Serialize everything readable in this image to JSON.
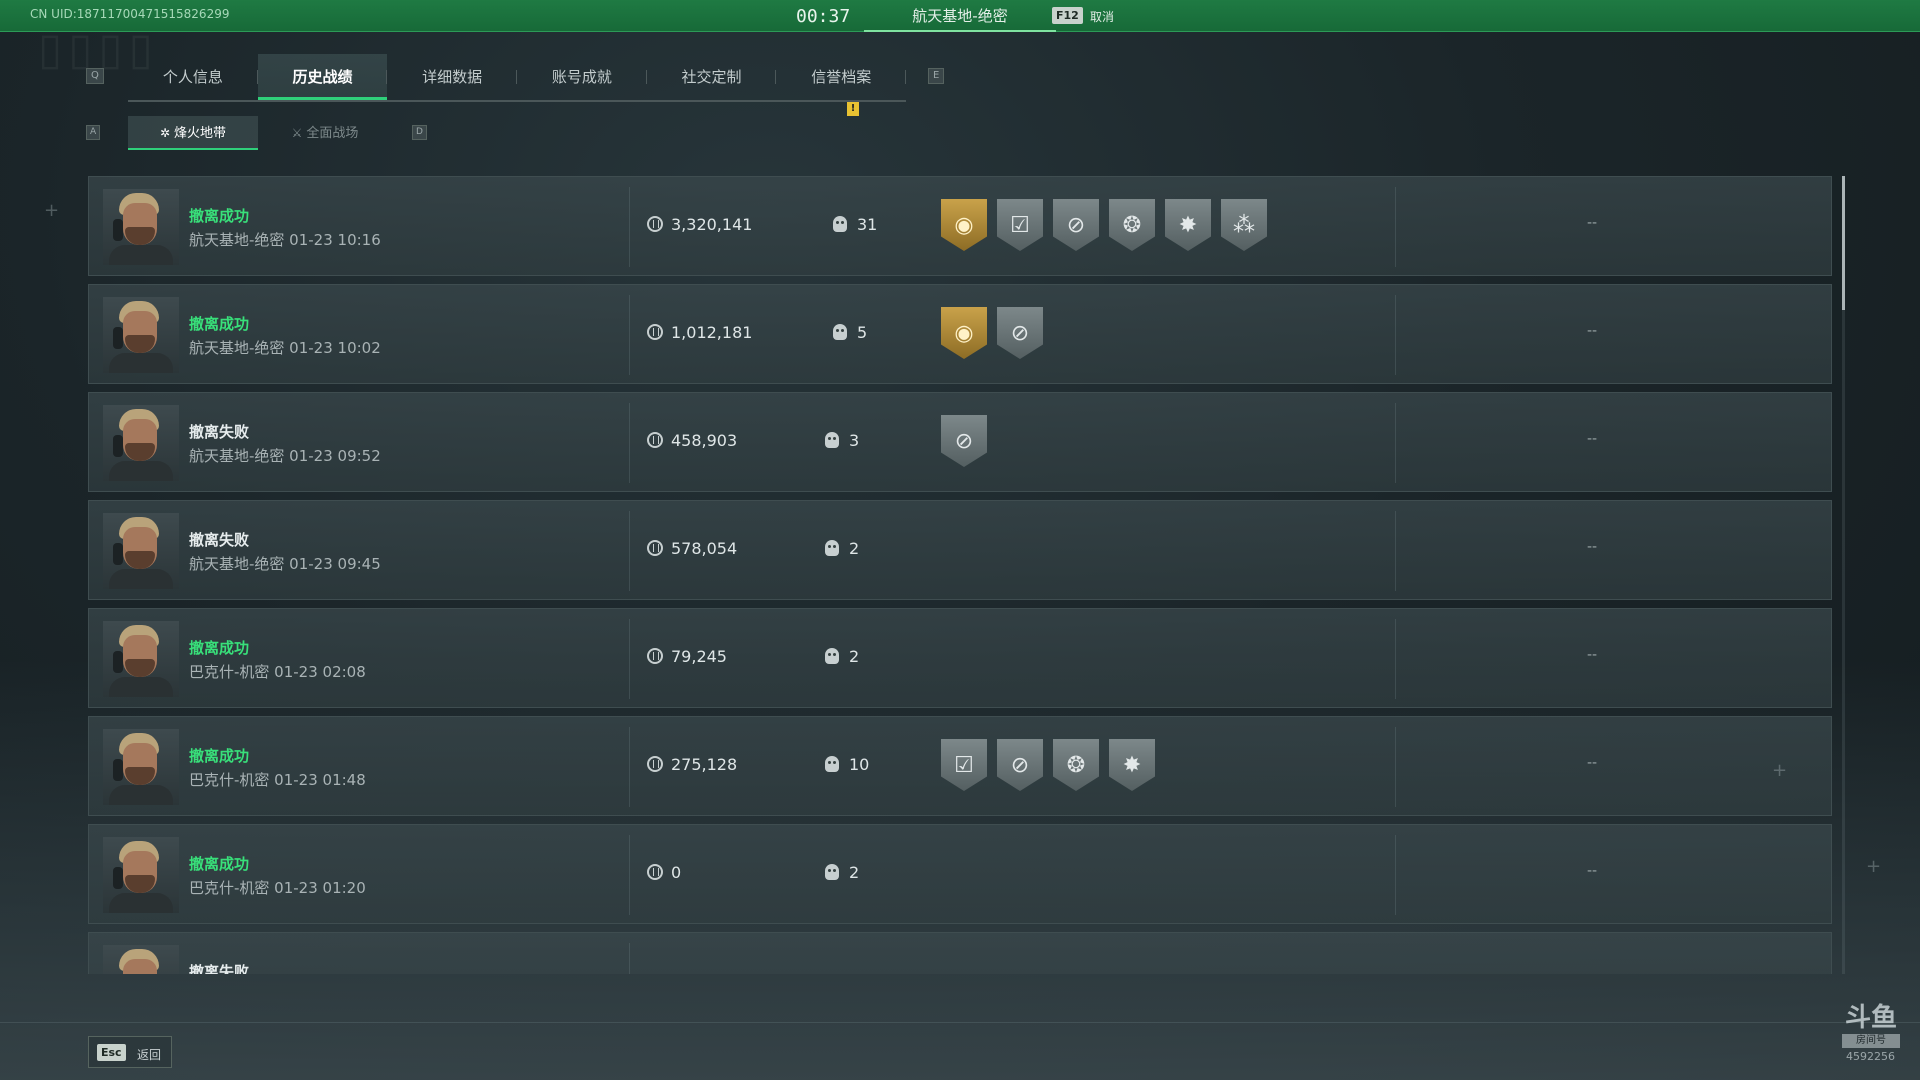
{
  "topbar": {
    "uid": "CN UID:18711700471515826299",
    "clock": "00:37",
    "map": "航天基地-绝密",
    "key": "F12",
    "cancel": "取消"
  },
  "tabs": {
    "key_left": "Q",
    "key_right": "E",
    "items": [
      "个人信息",
      "历史战绩",
      "详细数据",
      "账号成就",
      "社交定制",
      "信誉档案"
    ],
    "active": "历史战绩",
    "alert": "!"
  },
  "subtabs": {
    "key_left": "A",
    "key_right": "D",
    "items": [
      "烽火地带",
      "全面战场"
    ],
    "active": "烽火地带"
  },
  "matches": [
    {
      "result": "撤离成功",
      "status": "success",
      "meta": "航天基地-绝密 01-23 10:16",
      "value": "3,320,141",
      "kills": "31",
      "badges": [
        "gold-rank-icon",
        "shield-check-icon",
        "no-target-icon",
        "winged-skull-icon",
        "burst-icon",
        "ammo-icon"
      ],
      "extra": "--"
    },
    {
      "result": "撤离成功",
      "status": "success",
      "meta": "航天基地-绝密 01-23 10:02",
      "value": "1,012,181",
      "kills": "5",
      "badges": [
        "gold-rank-icon",
        "no-target-icon"
      ],
      "extra": "--"
    },
    {
      "result": "撤离失败",
      "status": "fail",
      "meta": "航天基地-绝密 01-23 09:52",
      "value": "458,903",
      "kills": "3",
      "badges": [
        "no-target-icon"
      ],
      "extra": "--"
    },
    {
      "result": "撤离失败",
      "status": "fail",
      "meta": "航天基地-绝密 01-23 09:45",
      "value": "578,054",
      "kills": "2",
      "badges": [],
      "extra": "--"
    },
    {
      "result": "撤离成功",
      "status": "success",
      "meta": "巴克什-机密 01-23 02:08",
      "value": "79,245",
      "kills": "2",
      "badges": [],
      "extra": "--"
    },
    {
      "result": "撤离成功",
      "status": "success",
      "meta": "巴克什-机密 01-23 01:48",
      "value": "275,128",
      "kills": "10",
      "badges": [
        "shield-check-icon",
        "no-target-icon",
        "winged-skull-icon",
        "burst-icon"
      ],
      "extra": "--"
    },
    {
      "result": "撤离成功",
      "status": "success",
      "meta": "巴克什-机密 01-23 01:20",
      "value": "0",
      "kills": "2",
      "badges": [],
      "extra": "--"
    },
    {
      "result": "撤离失败",
      "status": "fail",
      "meta": "",
      "value": "",
      "kills": "",
      "badges": [],
      "extra": ""
    }
  ],
  "footer": {
    "esc_key": "Esc",
    "esc_label": "返回",
    "logo": "斗鱼",
    "logo_sub": "房间号",
    "logo_num": "4592256"
  },
  "colors": {
    "topbar": "#1f7a43",
    "success": "#38e07a",
    "active_tab_accent": "#2fd07a",
    "gold_badge": "#c9a24a"
  }
}
